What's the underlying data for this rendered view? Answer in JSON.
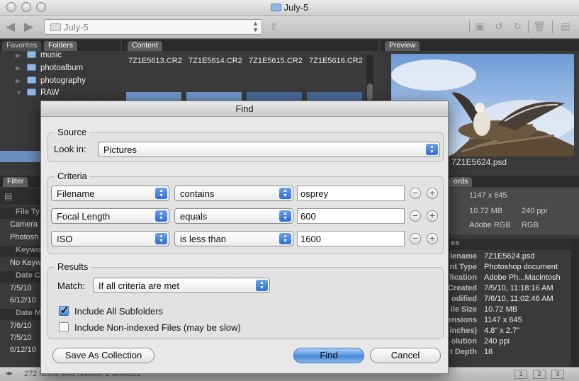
{
  "window": {
    "title": "July-5"
  },
  "toolbar": {
    "path": "July-5"
  },
  "left_tabs": {
    "favorites": "Favorites",
    "folders": "Folders"
  },
  "folders": [
    "music",
    "photoalbum",
    "photography",
    "RAW"
  ],
  "content": {
    "tab": "Content",
    "files": [
      "7Z1E5613.CR2",
      "7Z1E5614.CR2",
      "7Z1E5615.CR2",
      "7Z1E5616.CR2"
    ]
  },
  "preview": {
    "tab": "Preview",
    "caption": "7Z1E5624.psd"
  },
  "filter": {
    "tab": "Filter",
    "rows": [
      {
        "text": "File Ty",
        "head": true
      },
      {
        "text": "Camera",
        "head": false
      },
      {
        "text": "Photosh",
        "head": false
      },
      {
        "text": "Keywo",
        "head": true
      },
      {
        "text": "No Keyw",
        "head": false
      },
      {
        "text": "Date C",
        "head": true
      },
      {
        "text": "7/5/10",
        "head": false
      },
      {
        "text": "6/12/10",
        "head": false
      },
      {
        "text": "Date M",
        "head": true
      },
      {
        "text": "7/6/10",
        "head": false
      },
      {
        "text": "7/5/10",
        "head": false
      },
      {
        "text": "6/12/10",
        "head": false
      }
    ]
  },
  "metadata": {
    "tab": "ords",
    "summary": {
      "dimensions": "1147 x 645",
      "size": "10.72 MB",
      "ppi": "240 ppi",
      "profile": "Adobe RGB",
      "mode": "RGB"
    },
    "section": "es",
    "rows": [
      {
        "k": "lename",
        "v": "7Z1E5624.psd"
      },
      {
        "k": "nt Type",
        "v": "Photoshop document"
      },
      {
        "k": "lication",
        "v": "Adobe Ph...Macintosh"
      },
      {
        "k": "Created",
        "v": "7/5/10, 11:18:16 AM"
      },
      {
        "k": "odified",
        "v": "7/6/10, 11:02:46 AM"
      },
      {
        "k": "ile Size",
        "v": "10.72 MB"
      },
      {
        "k": "ensions",
        "v": "1147 x 645"
      },
      {
        "k": "inches)",
        "v": "4.8\" x 2.7\""
      },
      {
        "k": "olution",
        "v": "240 ppi"
      },
      {
        "k": "t Depth",
        "v": "16"
      }
    ]
  },
  "status": {
    "text": "272 items, one hidden, 1 selected",
    "views": [
      "1",
      "2",
      "3"
    ]
  },
  "dialog": {
    "title": "Find",
    "source": {
      "label": "Source",
      "look_in_label": "Look in:",
      "look_in_value": "Pictures"
    },
    "criteria": {
      "label": "Criteria",
      "rows": [
        {
          "field": "Filename",
          "op": "contains",
          "value": "osprey"
        },
        {
          "field": "Focal Length",
          "op": "equals",
          "value": "600"
        },
        {
          "field": "ISO",
          "op": "is less than",
          "value": "1600"
        }
      ]
    },
    "results": {
      "label": "Results",
      "match_label": "Match:",
      "match_value": "If all criteria are met",
      "include_subfolders": "Include All Subfolders",
      "include_subfolders_checked": true,
      "include_nonindexed": "Include Non-indexed Files (may be slow)",
      "include_nonindexed_checked": false
    },
    "buttons": {
      "save": "Save As Collection",
      "find": "Find",
      "cancel": "Cancel"
    }
  },
  "colors": {
    "dialog_bg": "#e8e8e8",
    "panel_bg": "#393939",
    "accent_blue": "#4584d8"
  }
}
